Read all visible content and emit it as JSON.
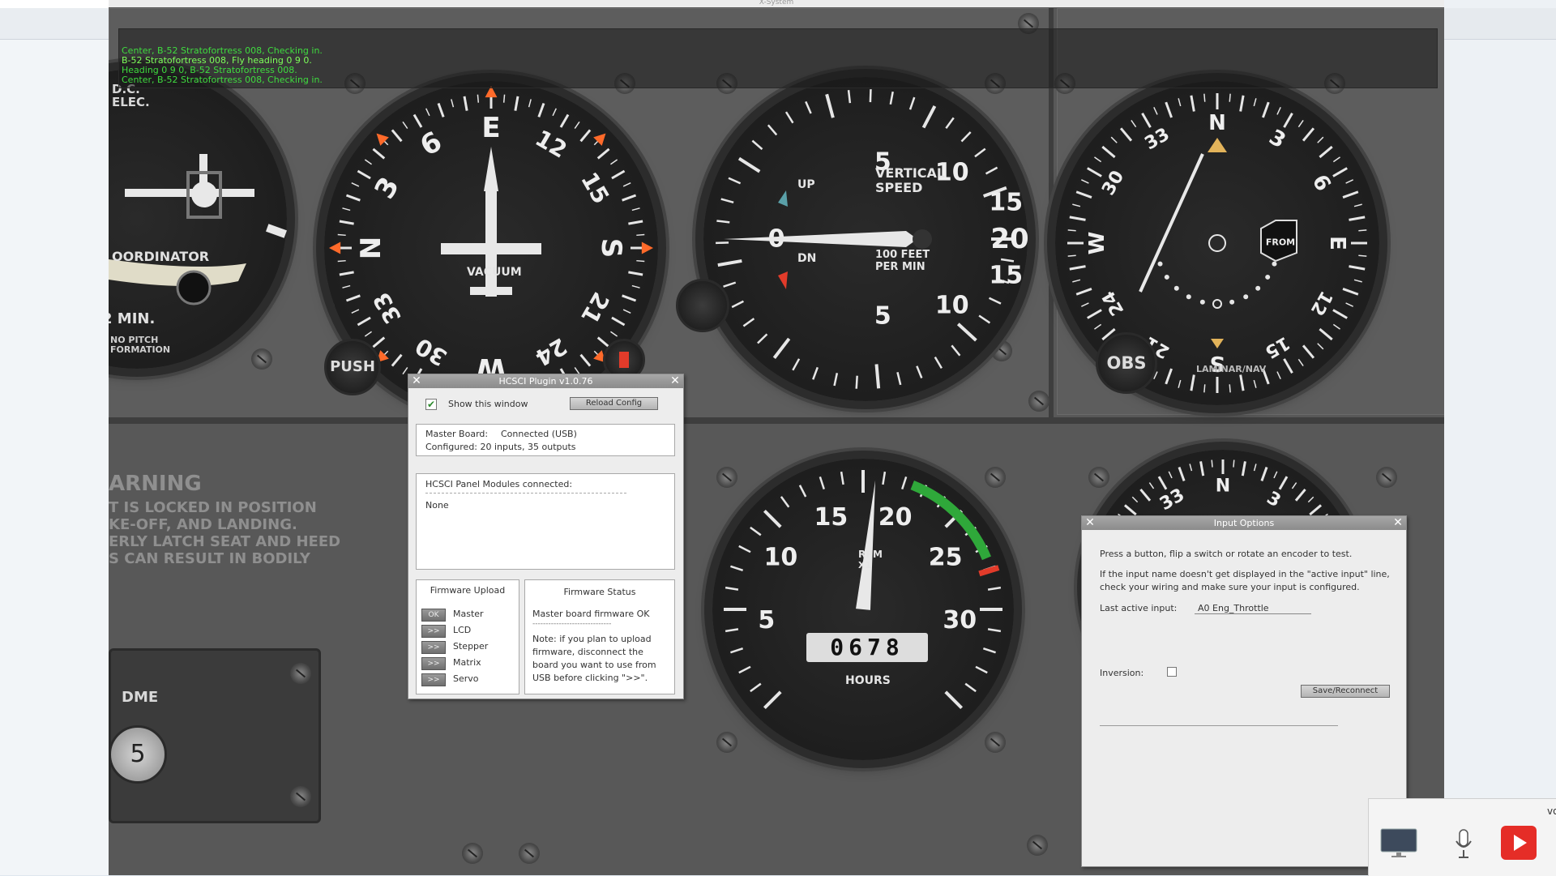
{
  "window": {
    "title": "X-System"
  },
  "atc": {
    "messages": [
      "Center, B-52 Stratofortress 008, Checking in.",
      "B-52 Stratofortress 008, Fly heading 0 9 0.",
      "Heading 0 9 0, B-52 Stratofortress 008.",
      "Center, B-52 Stratofortress 008, Checking in."
    ]
  },
  "panel": {
    "dc_elec": "D.C.\nELEC.",
    "coordinator": "OORDINATOR",
    "min": "2 MIN.",
    "no_pitch": "NO PITCH\nFORMATION",
    "r": "R",
    "push": "PUSH",
    "warning_title": "ARNING",
    "warning_lines": [
      "T IS LOCKED IN POSITION",
      "KE-OFF, AND LANDING.",
      "ERLY LATCH SEAT AND HEED",
      "S CAN RESULT IN BODILY"
    ],
    "dme": "DME",
    "dme_knob": "5",
    "heading_labels": [
      "N",
      "3",
      "6",
      "E",
      "12",
      "15",
      "S",
      "21",
      "24",
      "W",
      "30",
      "33"
    ],
    "vacuum": "VACUUM",
    "vsi_labels": [
      "5",
      "10",
      "15",
      "20",
      "15",
      "10",
      "5",
      "0"
    ],
    "vsi_up": "UP",
    "vsi_dn": "DN",
    "vsi_title": "VERTICAL\nSPEED",
    "vsi_units": "100 FEET\nPER MIN",
    "nav_labels": [
      "N",
      "3",
      "6",
      "E",
      "12",
      "15",
      "S",
      "21",
      "24",
      "W",
      "30",
      "33"
    ],
    "nav_from": "FROM",
    "obs": "OBS",
    "laminar": "LAMINAR/NAV",
    "tach_labels": [
      "5",
      "10",
      "15",
      "20",
      "25",
      "30"
    ],
    "tach_rpm": "RPM",
    "tach_x": "X1",
    "tach_counter": "0678",
    "tach_hours": "HOURS"
  },
  "hcsci": {
    "title": "HCSCI Plugin v1.0.76",
    "show_window_label": "Show this window",
    "show_window_checked": true,
    "reload_label": "Reload Config",
    "master_board_label": "Master Board:",
    "master_board_value": "Connected (USB)",
    "configured": "Configured: 20 inputs, 35 outputs",
    "modules_title": "HCSCI Panel Modules connected:",
    "modules_value": "None",
    "firmware_upload_title": "Firmware Upload",
    "firmware_items": [
      {
        "button": "OK",
        "label": "Master"
      },
      {
        "button": ">>",
        "label": "LCD"
      },
      {
        "button": ">>",
        "label": "Stepper"
      },
      {
        "button": ">>",
        "label": "Matrix"
      },
      {
        "button": ">>",
        "label": "Servo"
      }
    ],
    "firmware_status_title": "Firmware Status",
    "firmware_status_ok": "Master board firmware OK",
    "firmware_status_sep": "------------------------------",
    "firmware_note": [
      "Note: if you plan to upload",
      "firmware, disconnect the",
      "board you want to use from",
      "USB before clicking \">>\"."
    ]
  },
  "input_options": {
    "title": "Input Options",
    "line1": "Press a button, flip a switch or rotate an encoder to test.",
    "line2a": "If the input name doesn't get displayed in the \"active input\" line,",
    "line2b": "check your wiring and make sure your input is configured.",
    "last_active_label": "Last active input:",
    "last_active_value": "A0 Eng_Throttle",
    "inversion_label": "Inversion:",
    "inversion_checked": false,
    "save_label": "Save/Reconnect"
  },
  "tray": {
    "label": "vo"
  },
  "colors": {
    "atc_text": "#3fdc3f",
    "accent_red": "#e23b2a",
    "check_green": "#2d8a2d"
  }
}
